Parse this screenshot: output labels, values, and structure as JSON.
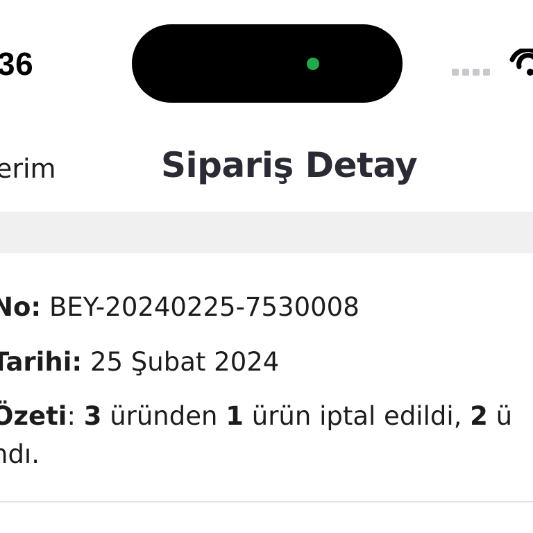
{
  "status_bar": {
    "time": "36"
  },
  "nav": {
    "back_label": "erim",
    "title": "Sipariş Detay"
  },
  "order": {
    "number_label": "No:",
    "number_value": " BEY-20240225-7530008",
    "date_label": "Tarihi:",
    "date_value": " 25 Şubat 2024",
    "summary_label": "Özeti",
    "summary_colon": ": ",
    "summary_total": "3",
    "summary_text_1": " üründen ",
    "summary_cancelled": "1",
    "summary_text_2": " ürün iptal edildi, ",
    "summary_remaining": "2",
    "summary_text_3": " ü",
    "summary_line2": "ndı."
  },
  "icons": {
    "signal": "cellular-signal-icon",
    "wifi": "wifi-icon"
  },
  "colors": {
    "island": "#000000",
    "island_indicator": "#23a84a",
    "separator_band": "#f0f0f0",
    "text": "#1c1c1e",
    "title": "#2b2b36"
  }
}
